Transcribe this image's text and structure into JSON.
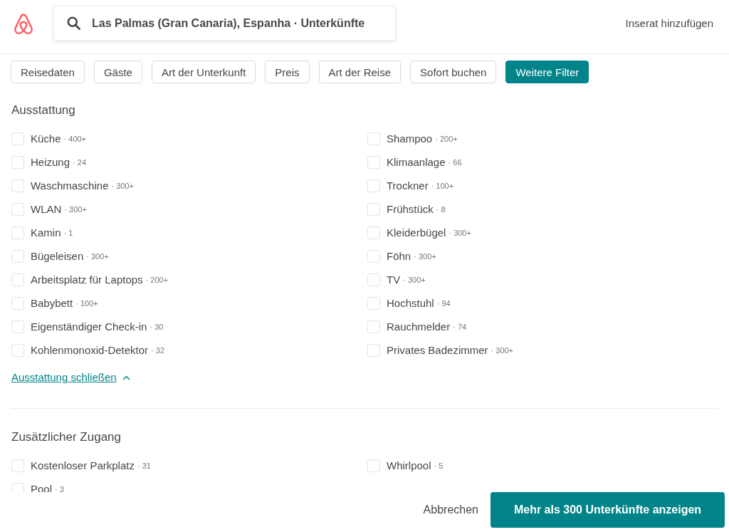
{
  "header": {
    "search": {
      "value": "Las Palmas (Gran Canaria), Espanha · Unterkünfte"
    },
    "link": "Inserat hinzufügen"
  },
  "filters": [
    {
      "label": "Reisedaten",
      "selected": false
    },
    {
      "label": "Gäste",
      "selected": false
    },
    {
      "label": "Art der Unterkunft",
      "selected": false
    },
    {
      "label": "Preis",
      "selected": false
    },
    {
      "label": "Art der Reise",
      "selected": false
    },
    {
      "label": "Sofort buchen",
      "selected": false
    },
    {
      "label": "Weitere Filter",
      "selected": true
    }
  ],
  "sections": [
    {
      "title": "Ausstattung",
      "items": [
        {
          "label": "Küche",
          "count": "· 400+",
          "checked": false
        },
        {
          "label": "Shampoo",
          "count": "· 200+",
          "checked": false
        },
        {
          "label": "Heizung",
          "count": "· 24",
          "checked": false
        },
        {
          "label": "Klimaanlage",
          "count": "· 66",
          "checked": false
        },
        {
          "label": "Waschmaschine",
          "count": "· 300+",
          "checked": false
        },
        {
          "label": "Trockner",
          "count": "· 100+",
          "checked": false
        },
        {
          "label": "WLAN",
          "count": "· 300+",
          "checked": false
        },
        {
          "label": "Frühstück",
          "count": "· 8",
          "checked": false
        },
        {
          "label": "Kamin",
          "count": "· 1",
          "checked": false
        },
        {
          "label": "Kleiderbügel",
          "count": "· 300+",
          "checked": false
        },
        {
          "label": "Bügeleisen",
          "count": "· 300+",
          "checked": false
        },
        {
          "label": "Föhn",
          "count": "· 300+",
          "checked": false
        },
        {
          "label": "Arbeitsplatz für Laptops",
          "count": "· 200+",
          "checked": false
        },
        {
          "label": "TV",
          "count": "· 300+",
          "checked": false
        },
        {
          "label": "Babybett",
          "count": "· 100+",
          "checked": false
        },
        {
          "label": "Hochstuhl",
          "count": "· 94",
          "checked": false
        },
        {
          "label": "Eigenständiger Check-in",
          "count": "· 30",
          "checked": false
        },
        {
          "label": "Rauchmelder",
          "count": "· 74",
          "checked": false
        },
        {
          "label": "Kohlenmonoxid-Detektor",
          "count": "· 32",
          "checked": false
        },
        {
          "label": "Privates Badezimmer",
          "count": "· 300+",
          "checked": false
        }
      ],
      "toggle": "Ausstattung schließen"
    },
    {
      "title": "Zusätzlicher Zugang",
      "items": [
        {
          "label": "Kostenloser Parkplatz",
          "count": "· 31",
          "checked": false
        },
        {
          "label": "Whirlpool",
          "count": "· 5",
          "checked": false
        },
        {
          "label": "Pool",
          "count": "· 3",
          "checked": false
        }
      ]
    }
  ],
  "footer": {
    "cancel": "Abbrechen",
    "submit": "Mehr als 300 Unterkünfte anzeigen"
  }
}
